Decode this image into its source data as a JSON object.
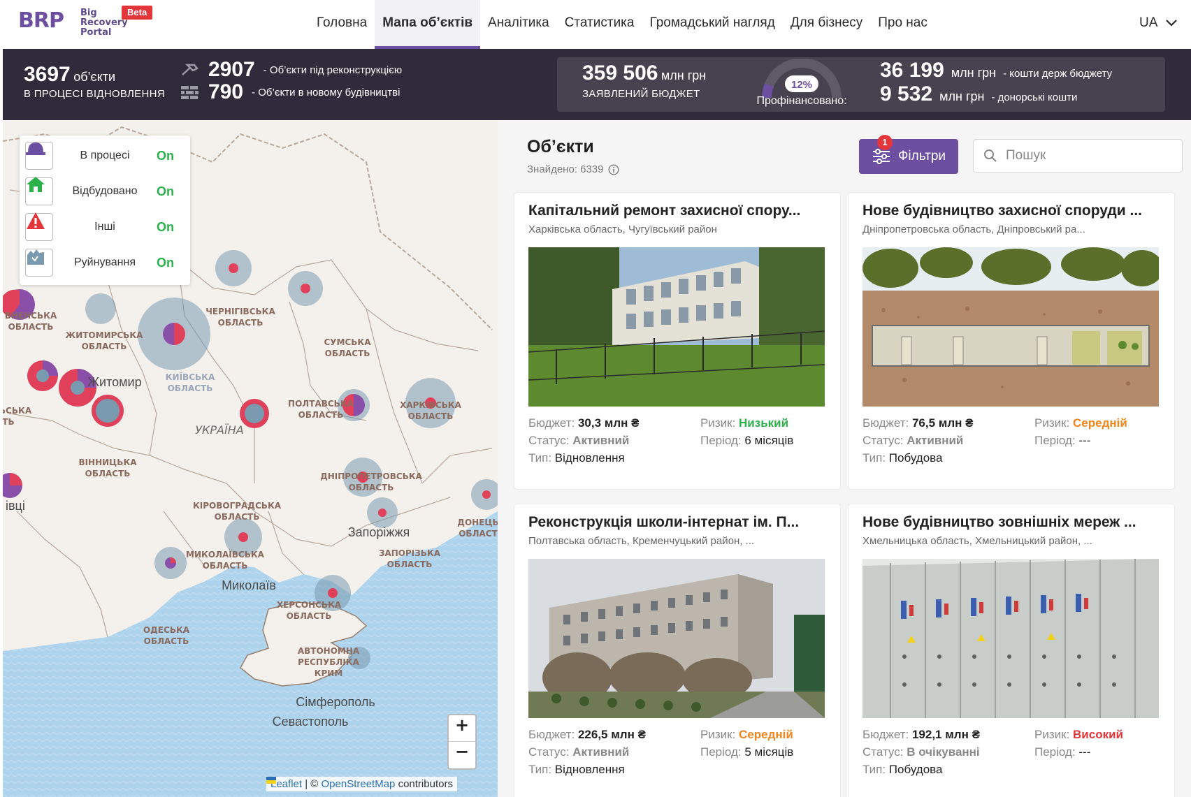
{
  "nav": {
    "logo_brp": "BRP",
    "logo_sub": [
      "Big",
      "Recovery",
      "Portal"
    ],
    "beta": "Beta",
    "items": [
      "Головна",
      "Мапа об’єктів",
      "Аналітика",
      "Статистика",
      "Громадський нагляд",
      "Для бізнесу",
      "Про нас"
    ],
    "active_index": 1,
    "lang": "UA"
  },
  "stats": {
    "in_progress_count": "3697",
    "in_progress_unit": "об’єкти",
    "in_progress_caption": "В ПРОЦЕСІ ВІДНОВЛЕННЯ",
    "reconstruction_count": "2907",
    "reconstruction_label": "- Об’єкти під реконструкцією",
    "new_build_count": "790",
    "new_build_label": "- Об’єкти в новому будівництві",
    "budget_value": "359 506",
    "budget_unit": "млн грн",
    "budget_caption": "ЗАЯВЛЕНИЙ БЮДЖЕТ",
    "cofinanced_percent": "12%",
    "cofinanced_fraction": 0.12,
    "cofinanced_label": "Профінансовано:",
    "state_value": "36 199",
    "state_unit": "млн грн",
    "state_label": "- кошти держ бюджету",
    "donor_value": "9 532",
    "donor_unit": "млн грн",
    "donor_label": "- донорські кошти"
  },
  "legend": [
    {
      "label": "В процесі",
      "state": "On",
      "icon": "helmet-icon"
    },
    {
      "label": "Відбудовано",
      "state": "On",
      "icon": "house-icon"
    },
    {
      "label": "Інші",
      "state": "On",
      "icon": "warning-icon"
    },
    {
      "label": "Руйнування",
      "state": "On",
      "icon": "ruins-icon"
    }
  ],
  "map": {
    "places": [
      "ЧЕРНІГІВСЬКА",
      "ОБЛАСТЬ",
      "СУМСЬКА",
      "ОБЛАСТЬ",
      "ЖИТОМИРСЬКА",
      "ОБЛАСТЬ",
      "Житомир",
      "КИЇВСЬКА",
      "ОБЛАСТЬ",
      "ПОЛТАВСЬКА",
      "ОБЛАСТЬ",
      "ХАРКІВСЬКА",
      "ОБЛАСТЬ",
      "УКРАЇНА",
      "ВІННИЦЬКА",
      "ОБЛАСТЬ",
      "ДНІПРОПЕТРОВСЬКА",
      "ОБЛАСТЬ",
      "КІРОВОГРАДСЬКА",
      "ОБЛАСТЬ",
      "Запоріжжя",
      "ДОНЕЦЬ",
      "ОБЛАСТ",
      "ЗАПОРІЗЬКА",
      "ОБЛАСТЬ",
      "МИКОЛАЇВСЬКА",
      "ОБЛАСТЬ",
      "Миколаїв",
      "ХЕРСОНСЬКА",
      "ОБЛАСТЬ",
      "ОДЕСЬКА",
      "ОБЛАСТЬ",
      "АВТОНОМНА",
      "РЕСПУБЛІКА",
      "КРИМ",
      "Сімферополь",
      "Севастополь",
      "ВНЕНСЬКА",
      "ОБЛАСТЬ",
      "ЬСЬКА",
      "ТЬ",
      "івці"
    ],
    "zoom_in": "+",
    "zoom_out": "−",
    "attribution_leaflet": "Leaflet",
    "attribution_sep": " | © ",
    "attribution_osm": "OpenStreetMap",
    "attribution_tail": " contributors"
  },
  "objects": {
    "title": "Об’єкти",
    "found": "Знайдено: 6339",
    "filters_label": "Фільтри",
    "filters_badge": "1",
    "search_placeholder": "Пошук",
    "labels": {
      "budget": "Бюджет:",
      "status": "Статус:",
      "type": "Тип:",
      "risk": "Ризик:",
      "period": "Період:"
    },
    "cards": [
      {
        "title": "Капітальний ремонт захисної спору...",
        "location": "Харківська область, Чугуївський район",
        "budget": "30,3 млн ₴",
        "status": "Активний",
        "type": "Відновлення",
        "risk": "Низький",
        "risk_level": "low",
        "period": "6 місяців"
      },
      {
        "title": "Нове будівництво захисної споруди ...",
        "location": "Дніпропетровська область, Дніпровський ра...",
        "budget": "76,5 млн ₴",
        "status": "Активний",
        "type": "Побудова",
        "risk": "Середній",
        "risk_level": "mid",
        "period": "---"
      },
      {
        "title": "Реконструкція школи-інтернат ім. П...",
        "location": "Полтавська область, Кременчуцький район, ...",
        "budget": "226,5 млн ₴",
        "status": "Активний",
        "type": "Відновлення",
        "risk": "Середній",
        "risk_level": "mid",
        "period": "5 місяців"
      },
      {
        "title": "Нове будівництво зовнішніх мереж ...",
        "location": "Хмельницька область, Хмельницький район, ...",
        "budget": "192,1 млн ₴",
        "status": "В очікуванні",
        "type": "Побудова",
        "risk": "Високий",
        "risk_level": "high",
        "period": "---"
      }
    ]
  },
  "colors": {
    "accent": "#6c4fa0",
    "green": "#2bb14a",
    "orange": "#f2851b",
    "red": "#e4353a",
    "dark": "#2f2b3a"
  }
}
